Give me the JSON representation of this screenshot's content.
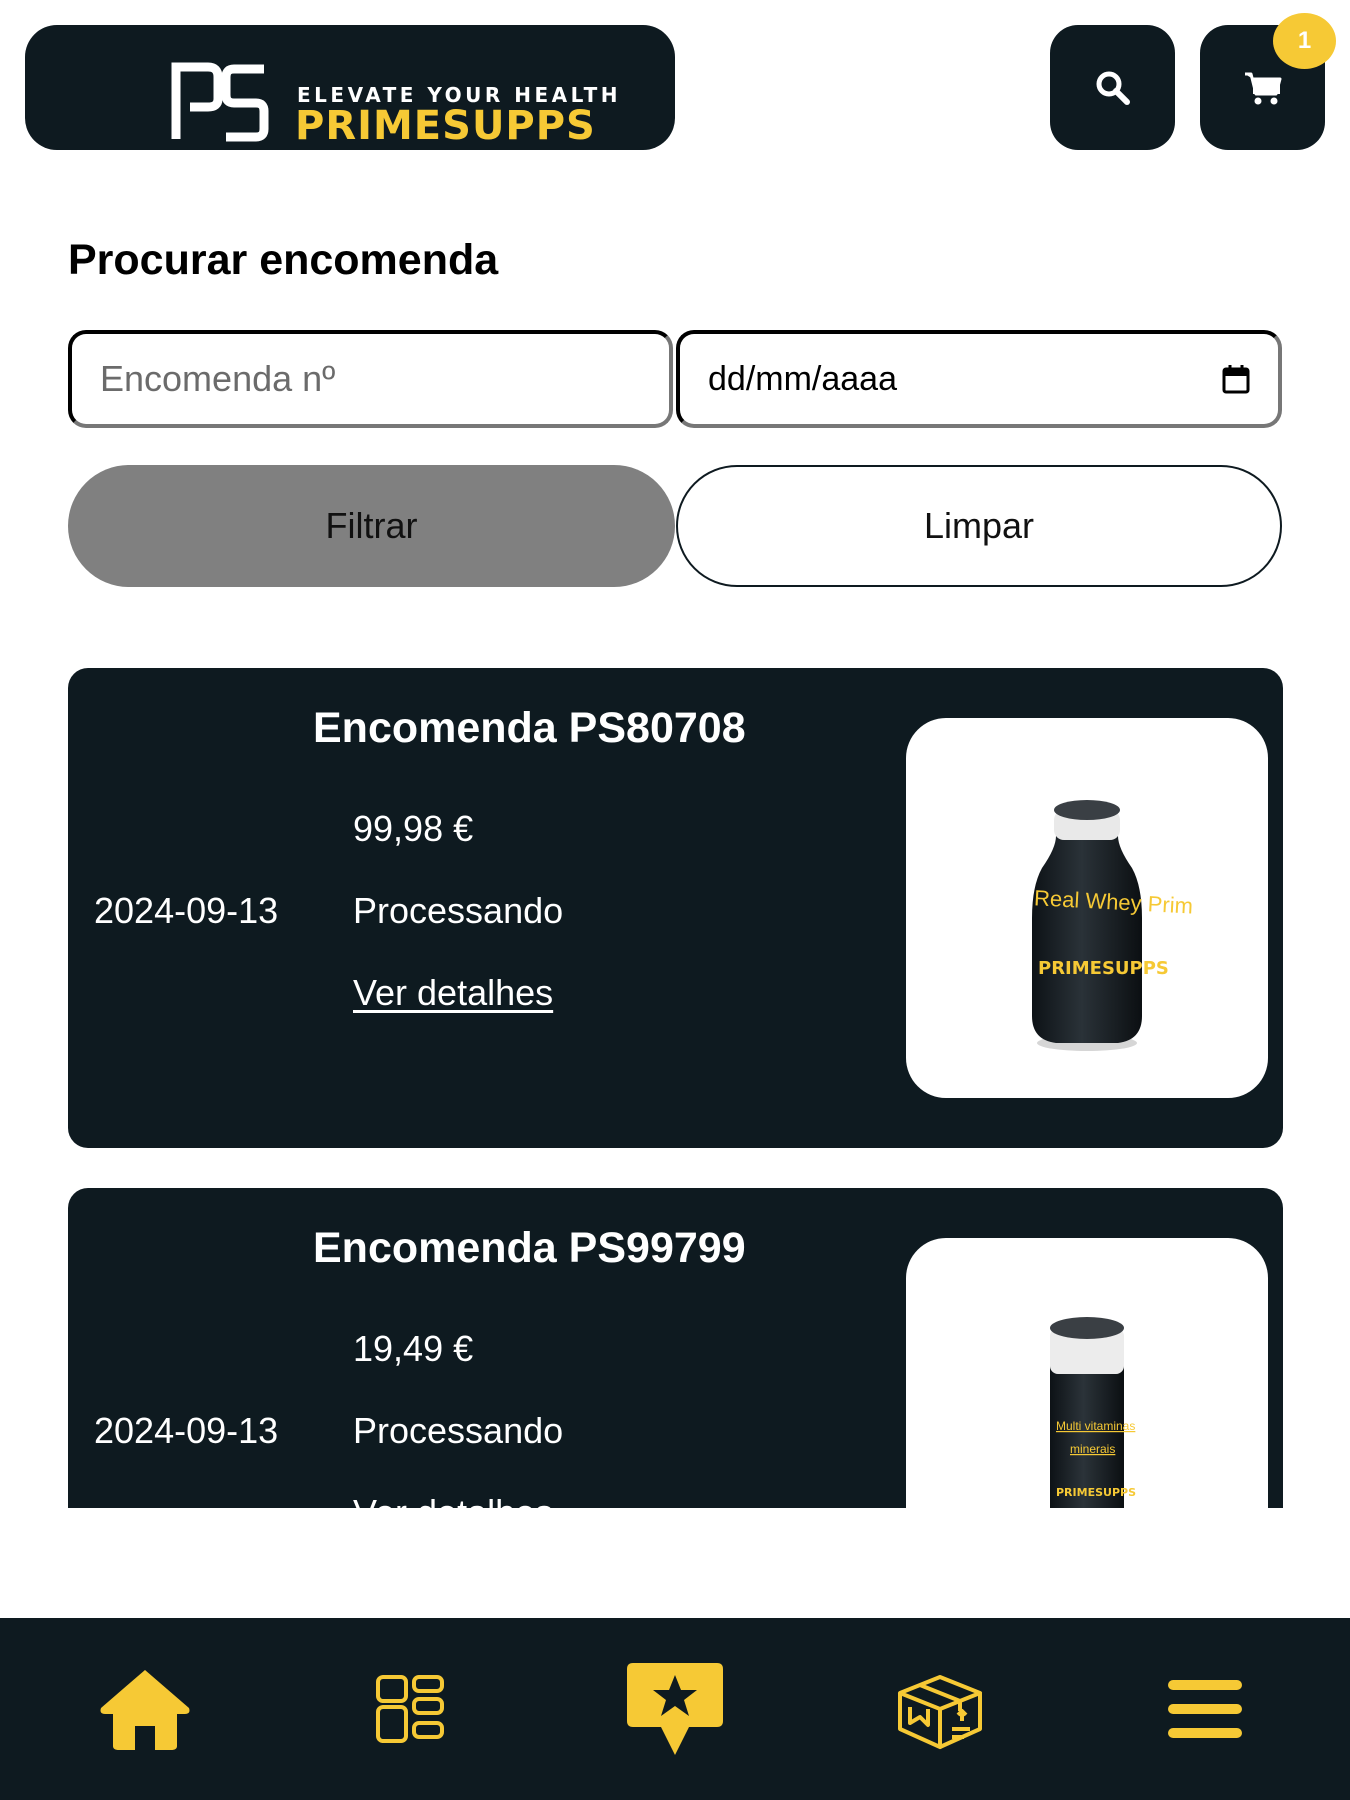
{
  "header": {
    "logo_monogram": "PS",
    "logo_tagline": "ELEVATE YOUR HEALTH",
    "logo_brand": "PRIMESUPPS",
    "search_icon": "search-icon",
    "cart_icon": "cart-icon",
    "cart_count": "1"
  },
  "search": {
    "title": "Procurar encomenda",
    "order_placeholder": "Encomenda nº",
    "date_value": "dd/mm/aaaa",
    "filter_label": "Filtrar",
    "clear_label": "Limpar"
  },
  "orders": [
    {
      "title": "Encomenda PS80708",
      "date": "2024-09-13",
      "price": "99,98 €",
      "status": "Processando",
      "link": "Ver detalhes",
      "product_label": "Real Whey Prim",
      "product_brand": "PRIMESUPPS"
    },
    {
      "title": "Encomenda PS99799",
      "date": "2024-09-13",
      "price": "19,49 €",
      "status": "Processando",
      "link": "Ver detalhes",
      "product_label_1": "Multi vitaminas",
      "product_label_2": "minerais",
      "product_brand": "PRIMESUPPS"
    }
  ],
  "nav": {
    "items": [
      "home-icon",
      "dashboard-icon",
      "rewards-icon",
      "orders-box-icon",
      "menu-icon"
    ]
  },
  "colors": {
    "dark": "#0e1a20",
    "accent": "#f6c935",
    "filter_button": "#808080"
  }
}
